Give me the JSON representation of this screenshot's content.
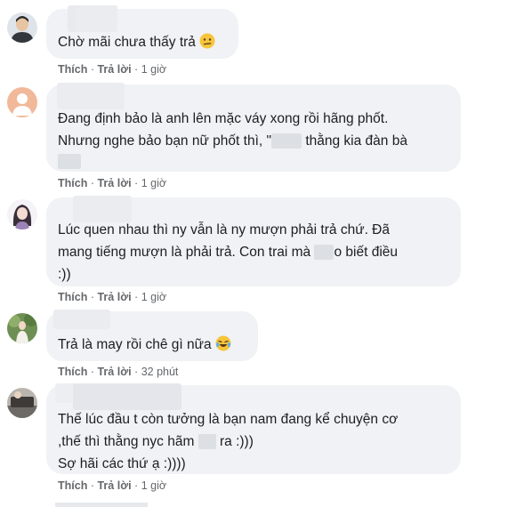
{
  "comments": [
    {
      "text_1": "Chờ mãi chưa thấy trả ",
      "emoji": "confused-face-emoji",
      "like": "Thích",
      "reply": "Trả lời",
      "time": "1 giờ"
    },
    {
      "line_1": "Đang định bảo là anh lên mặc váy xong rồi hãng phốt.",
      "line_2a": "Nhưng nghe bảo bạn nữ phốt thì, \"",
      "line_2b": "thằng kia đàn bà",
      "like": "Thích",
      "reply": "Trả lời",
      "time": "1 giờ"
    },
    {
      "line_1": "Lúc quen nhau thì ny vẫn là ny mượn phải trả chứ. Đã",
      "line_2a": "mang tiếng mượn là phải trả. Con trai mà",
      "line_2b": "o biết điều",
      "line_3": ":))",
      "like": "Thích",
      "reply": "Trả lời",
      "time": "1 giờ"
    },
    {
      "text_1": "Trả là may rồi chê gì nữa ",
      "emoji": "laughing-tears-emoji",
      "like": "Thích",
      "reply": "Trả lời",
      "time": "32 phút"
    },
    {
      "line_1": "Thế lúc đầu t còn tưởng là bạn nam đang kể chuyện cơ",
      "line_2a": ",thế thì thằng nyc hãm ",
      "line_2b": "ra :)))",
      "line_3": "Sợ hãi các thứ ạ :))))",
      "like": "Thích",
      "reply": "Trả lời",
      "time": "1 giờ"
    }
  ],
  "separator": "·"
}
